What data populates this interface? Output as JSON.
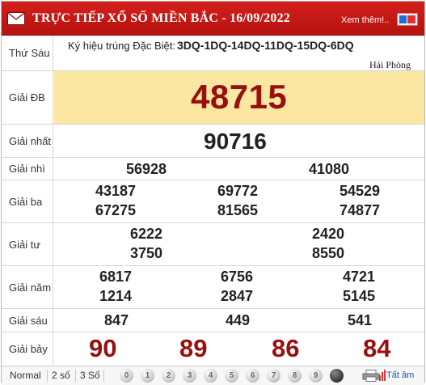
{
  "header": {
    "title": "TRỰC TIẾP XỔ SỐ MIỀN BẮC - 16/09/2022",
    "more_link": "Xem thêm!..",
    "mail_icon": "envelope-icon",
    "brand_color": "#c8191a"
  },
  "draw_info": {
    "day": "Thứ Sáu",
    "special_code_label": "Ký hiệu trúng Đặc Biệt:",
    "special_codes": "3DQ-1DQ-14DQ-11DQ-15DQ-6DQ",
    "region": "Hải Phòng"
  },
  "prizes": {
    "db": {
      "label": "Giải ĐB",
      "numbers": [
        "48715"
      ]
    },
    "nhat": {
      "label": "Giải nhất",
      "numbers": [
        "90716"
      ]
    },
    "nhi": {
      "label": "Giải nhì",
      "numbers": [
        "56928",
        "41080"
      ]
    },
    "ba": {
      "label": "Giải ba",
      "numbers": [
        "43187",
        "69772",
        "54529",
        "67275",
        "81565",
        "74877"
      ]
    },
    "tu": {
      "label": "Giải tư",
      "numbers": [
        "6222",
        "2420",
        "3750",
        "8550"
      ]
    },
    "nam": {
      "label": "Giải năm",
      "numbers": [
        "6817",
        "6756",
        "4721",
        "1214",
        "2847",
        "5145"
      ]
    },
    "sau": {
      "label": "Giải sáu",
      "numbers": [
        "847",
        "449",
        "541"
      ]
    },
    "bay": {
      "label": "Giải bảy",
      "numbers": [
        "90",
        "89",
        "86",
        "84"
      ]
    }
  },
  "footer": {
    "display_options": [
      "Normal",
      "2 số",
      "3 Số"
    ],
    "digit_balls": [
      "0",
      "1",
      "2",
      "3",
      "4",
      "5",
      "6",
      "7",
      "8",
      "9"
    ],
    "stats_label": "Tất âm"
  }
}
